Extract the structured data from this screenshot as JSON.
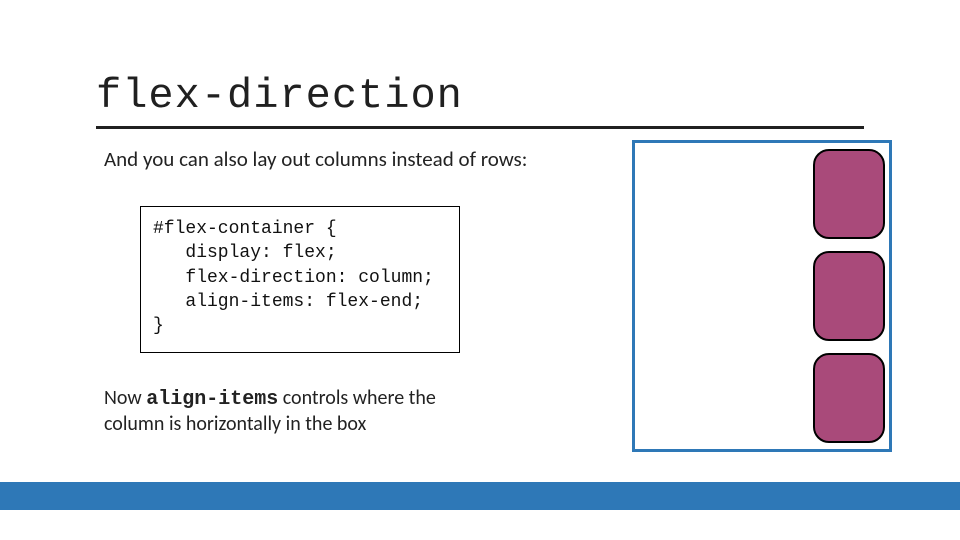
{
  "title": "flex-direction",
  "intro": "And you can also lay out columns instead of rows:",
  "code": {
    "line1": "#flex-container {",
    "line2": "   display: flex;",
    "line3": "   flex-direction: column;",
    "line4": "   align-items: flex-end;",
    "line5": "}"
  },
  "closing": {
    "pre": "Now ",
    "kw": "align-items",
    "post": " controls where the column is horizontally in the box"
  },
  "colors": {
    "accent_blue": "#2e78b7",
    "item_fill": "#a94a7a"
  },
  "demo": {
    "item_count": 3
  }
}
